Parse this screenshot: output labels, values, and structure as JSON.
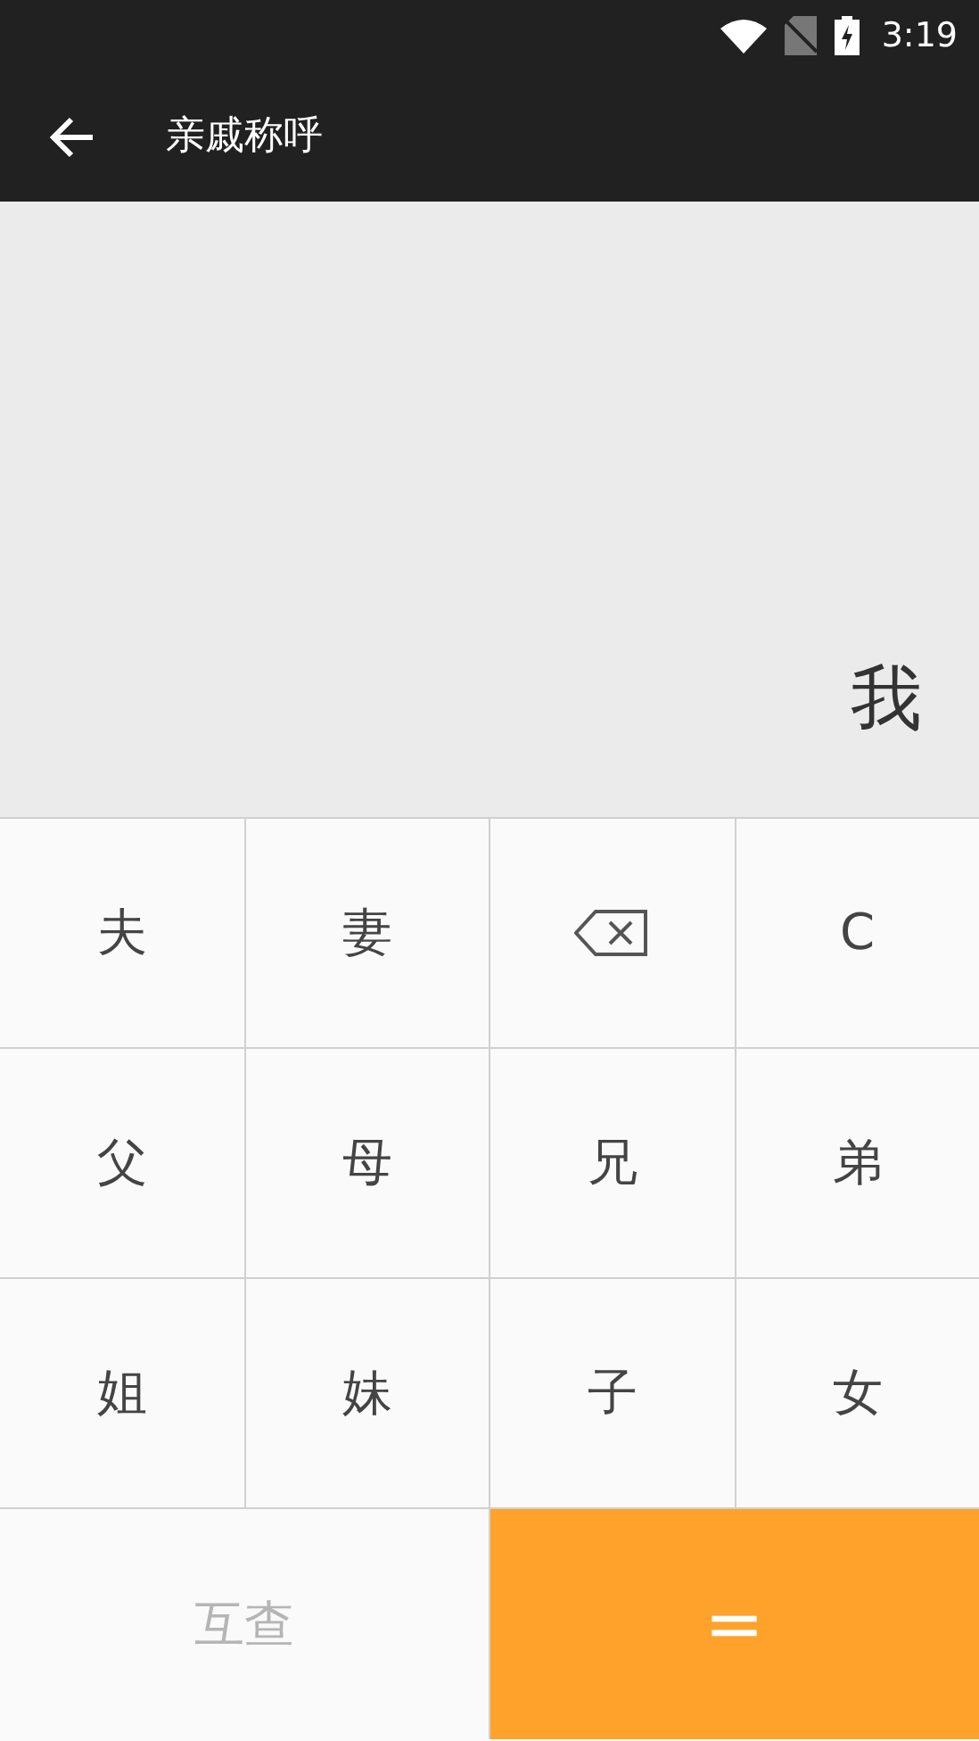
{
  "status_bar": {
    "time": "3:19"
  },
  "toolbar": {
    "title": "亲戚称呼"
  },
  "display": {
    "text": "我"
  },
  "keys": [
    {
      "kind": "text",
      "label": "夫"
    },
    {
      "kind": "text",
      "label": "妻"
    },
    {
      "kind": "backspace"
    },
    {
      "kind": "text",
      "label": "C"
    },
    {
      "kind": "text",
      "label": "父"
    },
    {
      "kind": "text",
      "label": "母"
    },
    {
      "kind": "text",
      "label": "兄"
    },
    {
      "kind": "text",
      "label": "弟"
    },
    {
      "kind": "text",
      "label": "姐"
    },
    {
      "kind": "text",
      "label": "妹"
    },
    {
      "kind": "text",
      "label": "子"
    },
    {
      "kind": "text",
      "label": "女"
    }
  ],
  "bottom_buttons": [
    {
      "kind": "plain",
      "label": "互查",
      "disabled": true
    },
    {
      "kind": "accent",
      "label": "=",
      "disabled": false
    }
  ]
}
